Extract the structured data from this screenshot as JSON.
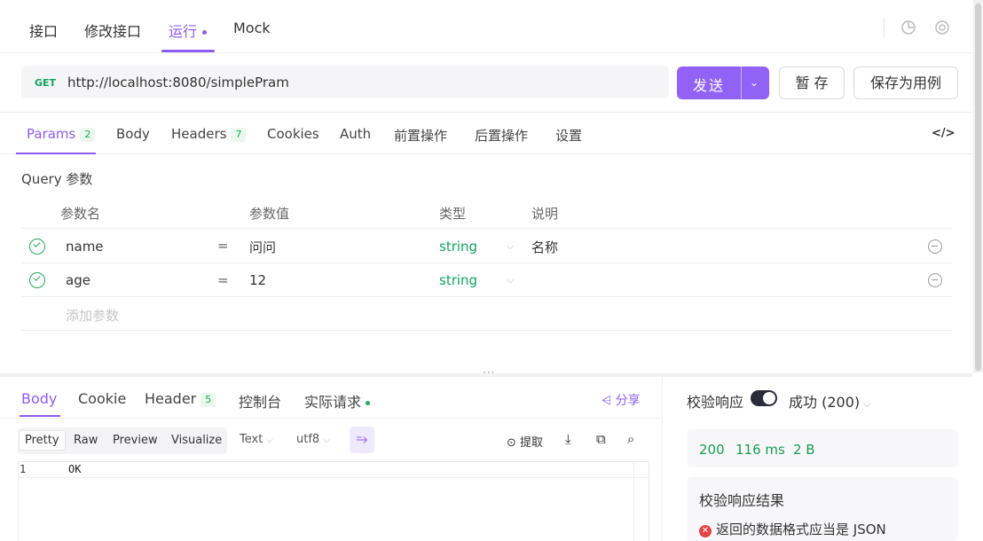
{
  "top_tabs": [
    {
      "label": "接口"
    },
    {
      "label": "修改接口"
    },
    {
      "label": "运行"
    },
    {
      "label": "Mock"
    }
  ],
  "request": {
    "method": "GET",
    "url": "http://localhost:8080/simplePram",
    "send_label": "发送",
    "save_temp_label": "暂 存",
    "save_case_label": "保存为用例"
  },
  "param_tabs": {
    "params": "Params",
    "params_count": "2",
    "body": "Body",
    "headers": "Headers",
    "headers_count": "7",
    "cookies": "Cookies",
    "auth": "Auth",
    "pre_ops": "前置操作",
    "post_ops": "后置操作",
    "settings": "设置",
    "code_icon": "</>"
  },
  "query": {
    "label": "Query 参数",
    "headers": {
      "name": "参数名",
      "value": "参数值",
      "type": "类型",
      "desc": "说明"
    },
    "rows": [
      {
        "name": "name",
        "value": "问问",
        "type": "string",
        "desc": "名称"
      },
      {
        "name": "age",
        "value": "12",
        "type": "string",
        "desc": ""
      }
    ],
    "add_placeholder": "添加参数",
    "eq": "="
  },
  "response": {
    "tabs": {
      "body": "Body",
      "cookie": "Cookie",
      "header": "Header",
      "header_count": "5",
      "console": "控制台",
      "actual_request": "实际请求"
    },
    "share": "分享",
    "view_tabs": [
      "Pretty",
      "Raw",
      "Preview",
      "Visualize"
    ],
    "format": "Text",
    "encoding": "utf8",
    "extract": "提取",
    "line_no": "1",
    "code": "OK"
  },
  "validation": {
    "label": "校验响应",
    "result_status": "成功 (200)",
    "status_code": "200",
    "time": "116 ms",
    "size": "2 B",
    "result_title": "校验响应结果",
    "error_message": "返回的数据格式应当是 JSON"
  },
  "colors": {
    "accent": "#8e5cf0",
    "success": "#23a55a",
    "error": "#e34343"
  }
}
